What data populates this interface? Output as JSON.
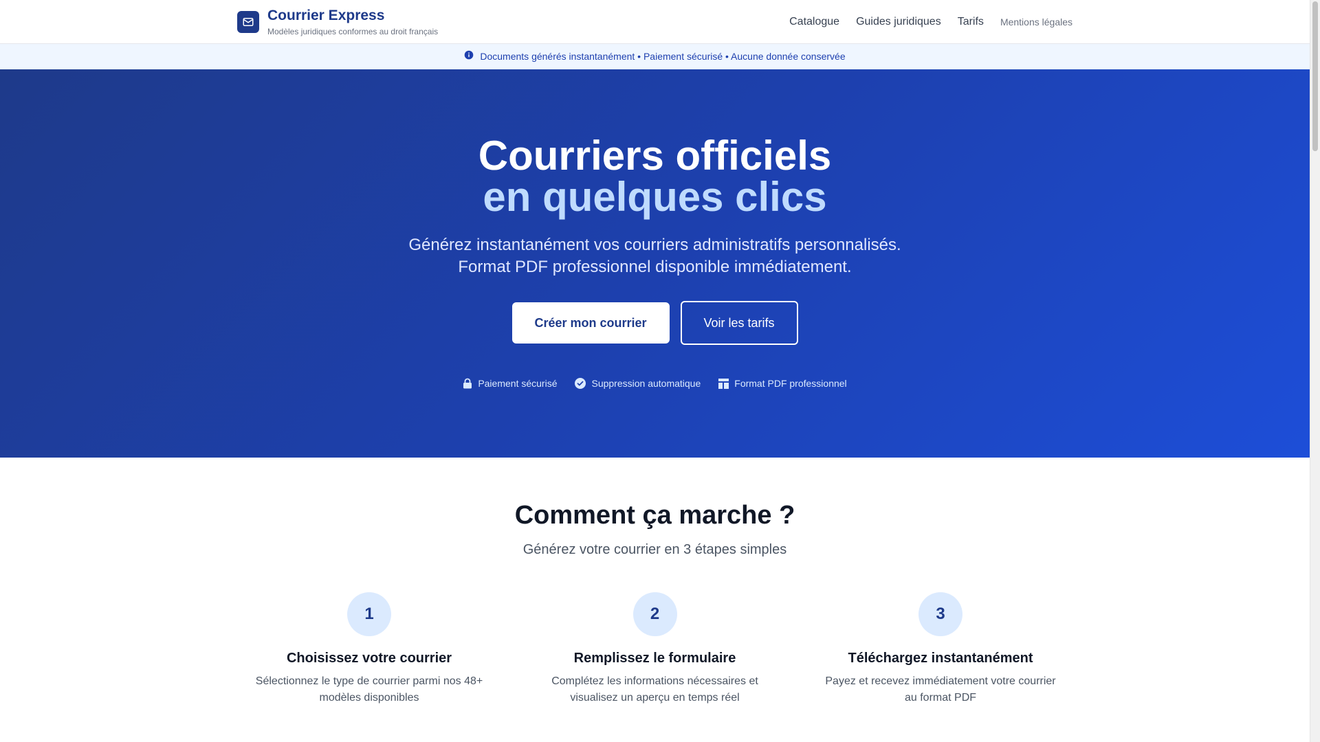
{
  "header": {
    "brand_name": "Courrier Express",
    "brand_tagline": "Modèles juridiques conformes au droit français",
    "nav": {
      "catalogue": "Catalogue",
      "guides": "Guides juridiques",
      "tarifs": "Tarifs",
      "mentions": "Mentions légales"
    }
  },
  "info_banner": {
    "text": "Documents générés instantanément • Paiement sécurisé • Aucune donnée conservée",
    "icon": "info-icon"
  },
  "hero": {
    "title_line1": "Courriers officiels",
    "title_line2": "en quelques clics",
    "subtitle_line1": "Générez instantanément vos courriers administratifs personnalisés.",
    "subtitle_line2": "Format PDF professionnel disponible immédiatement.",
    "primary_button": "Créer mon courrier",
    "secondary_button": "Voir les tarifs",
    "features": [
      {
        "icon": "lock-icon",
        "label": "Paiement sécurisé"
      },
      {
        "icon": "check-circle-icon",
        "label": "Suppression automatique"
      },
      {
        "icon": "document-layout-icon",
        "label": "Format PDF professionnel"
      }
    ]
  },
  "how_it_works": {
    "title": "Comment ça marche ?",
    "subtitle": "Générez votre courrier en 3 étapes simples",
    "steps": [
      {
        "number": "1",
        "title": "Choisissez votre courrier",
        "description": "Sélectionnez le type de courrier parmi nos 48+ modèles disponibles"
      },
      {
        "number": "2",
        "title": "Remplissez le formulaire",
        "description": "Complétez les informations nécessaires et visualisez un aperçu en temps réel"
      },
      {
        "number": "3",
        "title": "Téléchargez instantanément",
        "description": "Payez et recevez immédiatement votre courrier au format PDF"
      }
    ]
  },
  "colors": {
    "brand": "#1e3a8a",
    "hero_gradient_start": "#1e3a8a",
    "hero_gradient_end": "#1d4ed8",
    "hero_title_accent": "#bfdbfe",
    "banner_bg": "#eff6ff",
    "step_circle_bg": "#dbeafe"
  }
}
